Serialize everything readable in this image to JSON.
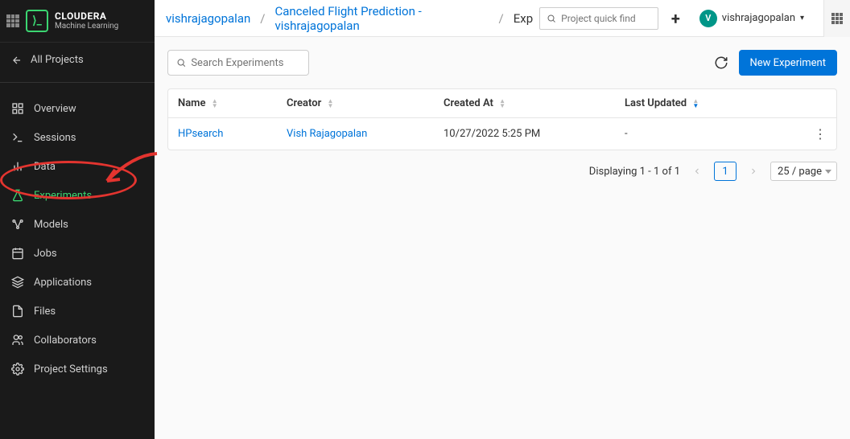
{
  "brand": {
    "name": "CLOUDERA",
    "sub": "Machine Learning",
    "logo_text": "⟩_"
  },
  "nav": {
    "back_label": "All Projects",
    "items": [
      {
        "id": "overview",
        "label": "Overview"
      },
      {
        "id": "sessions",
        "label": "Sessions"
      },
      {
        "id": "data",
        "label": "Data"
      },
      {
        "id": "experiments",
        "label": "Experiments",
        "active": true
      },
      {
        "id": "models",
        "label": "Models"
      },
      {
        "id": "jobs",
        "label": "Jobs"
      },
      {
        "id": "applications",
        "label": "Applications"
      },
      {
        "id": "files",
        "label": "Files"
      },
      {
        "id": "collaborators",
        "label": "Collaborators"
      },
      {
        "id": "project-settings",
        "label": "Project Settings"
      }
    ]
  },
  "breadcrumb": {
    "parent": "vishrajagopalan",
    "project": "Canceled Flight Prediction - vishrajagopalan",
    "current": "Experiments",
    "current_truncated": "Exp"
  },
  "header": {
    "quickfind_placeholder": "Project quick find",
    "user_initial": "V",
    "user_name": "vishrajagopalan"
  },
  "experiments": {
    "search_placeholder": "Search Experiments",
    "new_button": "New Experiment",
    "columns": {
      "name": "Name",
      "creator": "Creator",
      "created_at": "Created At",
      "last_updated": "Last Updated"
    },
    "rows": [
      {
        "name": "HPsearch",
        "creator": "Vish Rajagopalan",
        "created_at": "10/27/2022 5:25 PM",
        "last_updated": "-"
      }
    ],
    "pagination": {
      "summary": "Displaying 1 - 1 of 1",
      "page": "1",
      "page_size": "25 / page"
    }
  }
}
